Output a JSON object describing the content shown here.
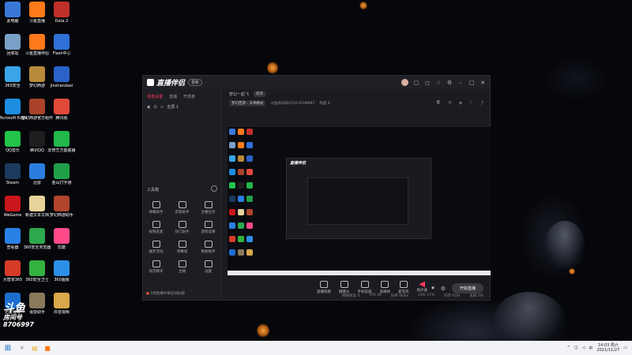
{
  "desktop": {
    "icons": [
      {
        "label": "此电脑",
        "color": "#3a78d8"
      },
      {
        "label": "斗鱼直播",
        "color": "#ff7a1a"
      },
      {
        "label": "Dota 2",
        "color": "#c0302a"
      },
      {
        "label": "回收站",
        "color": "#7aa0c8"
      },
      {
        "label": "斗鱼直播伴侣",
        "color": "#ff7a1a"
      },
      {
        "label": "Flash中心",
        "color": "#2f6fd6"
      },
      {
        "label": "360安全",
        "color": "#3aa4e8"
      },
      {
        "label": "梦幻西游",
        "color": "#b88a3a"
      },
      {
        "label": "jinshandaxi",
        "color": "#2a62c8"
      },
      {
        "label": "Microsoft Edge",
        "color": "#1d8de0"
      },
      {
        "label": "梦幻西游官方组件",
        "color": "#a9432a"
      },
      {
        "label": "腾讯视",
        "color": "#e04a3a"
      },
      {
        "label": "QQ音乐",
        "color": "#24c44a"
      },
      {
        "label": "腾讯QQ",
        "color": "#1e1e1e"
      },
      {
        "label": "爱奇艺万能联播",
        "color": "#22b84a"
      },
      {
        "label": "Steam",
        "color": "#1b3a5c"
      },
      {
        "label": "迅雷",
        "color": "#2b7de0"
      },
      {
        "label": "金山打字通",
        "color": "#21a04a"
      },
      {
        "label": "WeGame",
        "color": "#c8161a"
      },
      {
        "label": "新建文本文档",
        "color": "#e6d39a"
      },
      {
        "label": "梦幻西游助手",
        "color": "#b0452c"
      },
      {
        "label": "查看器",
        "color": "#2980e6"
      },
      {
        "label": "360安全浏览器",
        "color": "#2ca84e"
      },
      {
        "label": "优酷",
        "color": "#ff4a8a"
      },
      {
        "label": "大智慧365",
        "color": "#d63b2a"
      },
      {
        "label": "360安全卫士",
        "color": "#33b240"
      },
      {
        "label": "360画报",
        "color": "#2c8fe8"
      },
      {
        "label": "迅雷看看",
        "color": "#1c6fd0"
      },
      {
        "label": "语音助手",
        "color": "#8a7a5a"
      },
      {
        "label": "抖音视频",
        "color": "#d8a84a"
      }
    ]
  },
  "overlay": {
    "line1": "斗鱼",
    "line2": "房间号",
    "line3": "8706997"
  },
  "window": {
    "logo": "直播伴侣",
    "version": "更新",
    "title_icons": [
      "avatar",
      "chat-icon",
      "message-icon",
      "shirt-icon",
      "settings-icon",
      "minimize-icon",
      "maximize-icon",
      "close-icon"
    ],
    "left_tabs": [
      {
        "label": "场景设置",
        "active": true
      },
      {
        "label": "直播",
        "active": false
      },
      {
        "label": "开发者",
        "active": false
      }
    ],
    "scene": {
      "label": "全屏 1"
    },
    "tools_title": "工具箱",
    "tools": [
      "弹幕助手",
      "房管助手",
      "主播任务",
      "视频连麦",
      "热门助手",
      "游戏竞猜",
      "抽奖活动",
      "弹幕墙",
      "数据助手",
      "语音聊天",
      "主播",
      "设置"
    ],
    "bottom_tip": "5场直播中将启动标题",
    "room_title": "梦幻一起飞",
    "edit_label": "修改",
    "room_category": "梦幻西游 - 天神模式",
    "room_id": "斗鱼房间ID2150  8706997",
    "hot": "热度 0",
    "header_actions": [
      "trash-icon",
      "lock-icon",
      "copy-icon",
      "bell-icon",
      "share-icon"
    ],
    "controls": [
      "直播排版",
      "摄像头",
      "手机投屏",
      "多媒体",
      "麦克风",
      "扬声器"
    ],
    "start_button": "开始直播",
    "status": [
      "网络状态 0",
      "FPS 30",
      "码率 0kb/s",
      "CPU 17%",
      "内存 65%",
      "丢帧 0%"
    ]
  },
  "taskbar": {
    "time": "14:03 周六",
    "date": "2021/11/27",
    "lang": "中"
  }
}
